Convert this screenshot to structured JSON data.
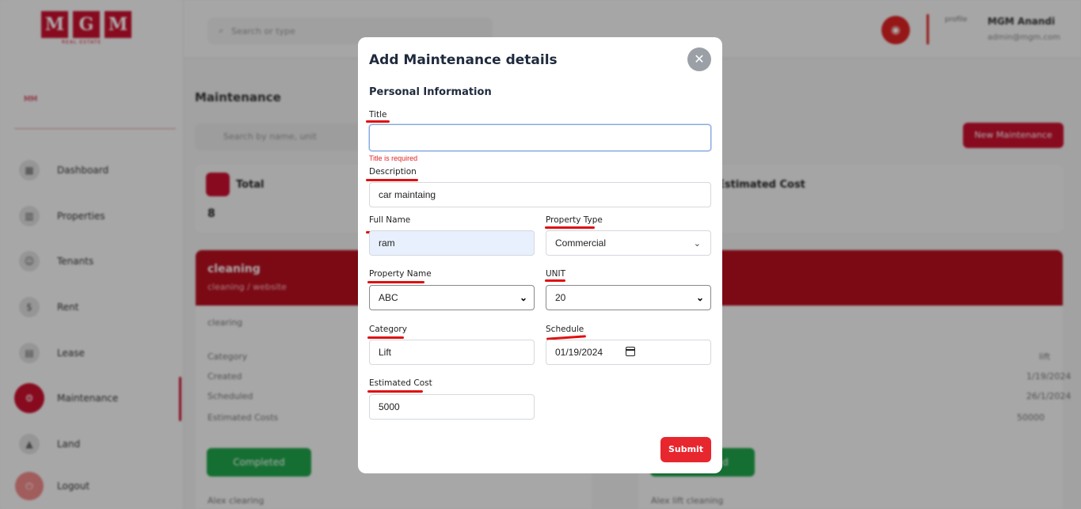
{
  "background": {
    "logo_letters": [
      "M",
      "G",
      "M"
    ],
    "logo_sub": "REAL ESTATE",
    "side_tag": "MM",
    "nav": [
      {
        "label": "Dashboard",
        "icon": "dashboard-icon"
      },
      {
        "label": "Properties",
        "icon": "building-icon"
      },
      {
        "label": "Tenants",
        "icon": "users-icon"
      },
      {
        "label": "Rent",
        "icon": "money-icon"
      },
      {
        "label": "Lease",
        "icon": "document-icon"
      },
      {
        "label": "Maintenance",
        "icon": "tools-icon",
        "active": true
      },
      {
        "label": "Land",
        "icon": "land-icon"
      },
      {
        "label": "Logout",
        "icon": "logout-icon"
      }
    ],
    "search_placeholder": "Search or type",
    "profile_alt": "profile",
    "user_name": "MGM Anandi",
    "user_email": "admin@mgm.com",
    "page_title": "Maintenance",
    "list_search_placeholder": "Search by name, unit",
    "new_button": "New Maintenance",
    "stat_total_label": "Total",
    "stat_total_value": "8",
    "stat_cost_label": "Estimated Cost",
    "card_title": "cleaning",
    "card_subtitle": "cleaning / website",
    "card_desc": "clearing",
    "card_rows": [
      "Category",
      "Created",
      "Scheduled",
      "Estimated Costs"
    ],
    "card_values": [
      "lift",
      "1/19/2024",
      "26/1/2024",
      "50000"
    ],
    "card_status": "Completed",
    "card_footer": "Alex clearing",
    "card2_footer": "Alex lift cleaning"
  },
  "modal": {
    "title": "Add Maintenance details",
    "section": "Personal Information",
    "fields": {
      "title": {
        "label": "Title",
        "value": "",
        "error": "Title is required"
      },
      "description": {
        "label": "Description",
        "value": "car maintaing"
      },
      "full_name": {
        "label": "Full Name",
        "value": "ram"
      },
      "property_type": {
        "label": "Property Type",
        "value": "Commercial"
      },
      "property_name": {
        "label": "Property Name",
        "value": "ABC"
      },
      "unit": {
        "label": "UNIT",
        "value": "20"
      },
      "category": {
        "label": "Category",
        "value": "Lift"
      },
      "schedule": {
        "label": "Schedule",
        "value": "01/19/2024"
      },
      "estimated_cost": {
        "label": "Estimated Cost",
        "value": "5000"
      }
    },
    "submit": "Submit",
    "close_symbol": "✕"
  },
  "colors": {
    "accent": "#e8262e",
    "brand": "#c8102e",
    "error": "#e02424",
    "annotation": "#e01010"
  }
}
